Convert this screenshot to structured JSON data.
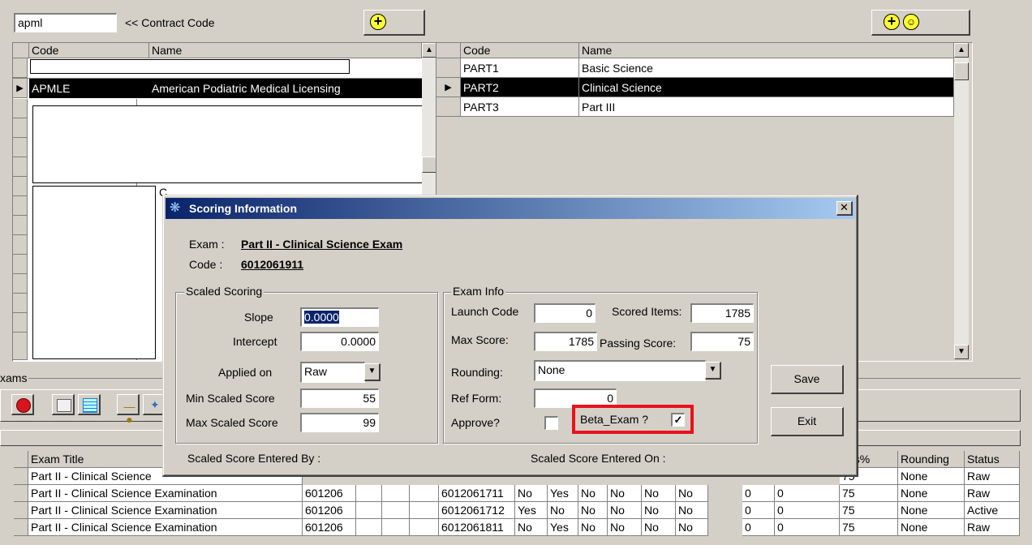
{
  "contract": {
    "input_value": "apml",
    "label": "<< Contract Code"
  },
  "left_grid": {
    "headers": [
      "Code",
      "Name"
    ],
    "selected_row": {
      "code": "APMLE",
      "name": "American Podiatric Medical Licensing"
    },
    "partial_text_1": "C"
  },
  "right_grid": {
    "headers": [
      "Code",
      "Name"
    ],
    "rows": [
      {
        "code": "PART1",
        "name": "Basic Science"
      },
      {
        "code": "PART2",
        "name": "Clinical Science"
      },
      {
        "code": "PART3",
        "name": "Part III"
      }
    ]
  },
  "exams_group_label": "xams",
  "bottom_table": {
    "headers": [
      "Exam Title",
      "ass%",
      "Rounding",
      "Status"
    ],
    "rows": [
      {
        "title": "Part II - Clinical Science Examination",
        "code": "601206",
        "form": "6012061711",
        "c1": "No",
        "c2": "Yes",
        "c3": "No",
        "c4": "No",
        "c5": "No",
        "c6": "No",
        "c7": "0",
        "c8": "0",
        "pass": "75",
        "rounding": "None",
        "status": "Raw"
      },
      {
        "title": "Part II - Clinical Science Examination",
        "code": "601206",
        "form": "6012061712",
        "c1": "Yes",
        "c2": "No",
        "c3": "No",
        "c4": "No",
        "c5": "No",
        "c6": "No",
        "c7": "0",
        "c8": "0",
        "pass": "75",
        "rounding": "None",
        "status": "Active"
      },
      {
        "title": "Part II - Clinical Science Examination",
        "code": "601206",
        "form": "6012061811",
        "c1": "No",
        "c2": "Yes",
        "c3": "No",
        "c4": "No",
        "c5": "No",
        "c6": "No",
        "c7": "0",
        "c8": "0",
        "pass": "75",
        "rounding": "None",
        "status": "Raw"
      }
    ],
    "partial_row": {
      "title": "Part II - Clinical Science",
      "pass": "75",
      "rounding": "None",
      "status": "Raw"
    }
  },
  "dialog": {
    "title": "Scoring Information",
    "exam_label": "Exam :",
    "exam_value": "Part II - Clinical Science Exam",
    "code_label": "Code :",
    "code_value": "6012061911",
    "scaled": {
      "group_title": "Scaled Scoring",
      "slope_label": "Slope",
      "slope_value": "0.0000",
      "intercept_label": "Intercept",
      "intercept_value": "0.0000",
      "applied_label": "Applied on",
      "applied_value": "Raw",
      "min_label": "Min Scaled Score",
      "min_value": "55",
      "max_label": "Max Scaled Score",
      "max_value": "99"
    },
    "info": {
      "group_title": "Exam Info",
      "launch_label": "Launch Code",
      "launch_value": "0",
      "scored_label": "Scored Items:",
      "scored_value": "1785",
      "max_label": "Max Score:",
      "max_value": "1785",
      "passing_label": "Passing Score:",
      "passing_value": "75",
      "rounding_label": "Rounding:",
      "rounding_value": "None",
      "ref_label": "Ref Form:",
      "ref_value": "0",
      "approve_label": "Approve?",
      "beta_label": "Beta_Exam ?"
    },
    "save_label": "Save",
    "exit_label": "Exit",
    "entered_by_label": "Scaled Score Entered By :",
    "entered_on_label": "Scaled Score Entered On :"
  },
  "colors": {
    "highlight": "#e8121c",
    "title_bar": "#0a246a",
    "selection": "#000000"
  }
}
